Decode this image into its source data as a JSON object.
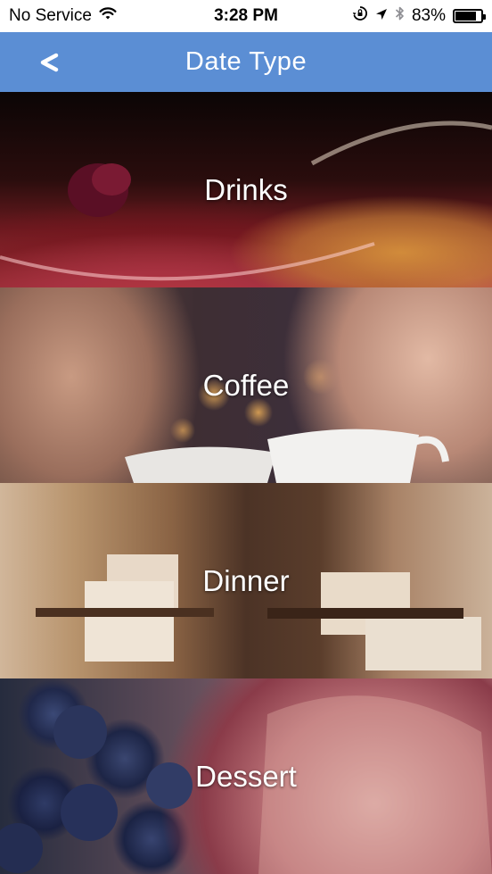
{
  "status": {
    "carrier": "No Service",
    "time": "3:28 PM",
    "battery_percent": "83%",
    "battery_level": 0.83
  },
  "nav": {
    "title": "Date Type",
    "back_label": "<"
  },
  "tiles": [
    {
      "label": "Drinks"
    },
    {
      "label": "Coffee"
    },
    {
      "label": "Dinner"
    },
    {
      "label": "Dessert"
    }
  ],
  "colors": {
    "nav_bar": "#5b8ed4",
    "text_light": "#ffffff"
  },
  "icons": [
    "wifi-icon",
    "rotation-lock-icon",
    "location-arrow-icon",
    "bluetooth-icon",
    "battery-icon"
  ]
}
